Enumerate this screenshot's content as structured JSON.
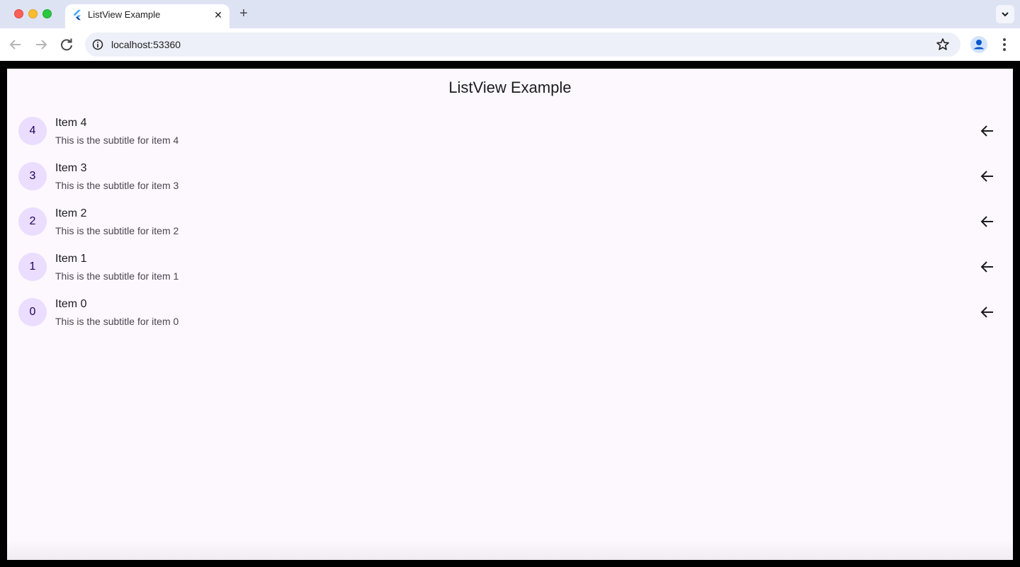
{
  "browser": {
    "tab_title": "ListView Example",
    "tab_close": "✕",
    "new_tab": "+",
    "url": "localhost:53360"
  },
  "colors": {
    "page_background": "#fdf8fd",
    "avatar_background": "#eaddff",
    "avatar_text": "#21005d",
    "title_text": "#1d1b20",
    "subtitle_text": "#49454f"
  },
  "app": {
    "title": "ListView Example",
    "items": [
      {
        "avatar": "4",
        "title": "Item 4",
        "subtitle": "This is the subtitle for item 4",
        "trailing_icon": "arrow-back-icon"
      },
      {
        "avatar": "3",
        "title": "Item 3",
        "subtitle": "This is the subtitle for item 3",
        "trailing_icon": "arrow-back-icon"
      },
      {
        "avatar": "2",
        "title": "Item 2",
        "subtitle": "This is the subtitle for item 2",
        "trailing_icon": "arrow-back-icon"
      },
      {
        "avatar": "1",
        "title": "Item 1",
        "subtitle": "This is the subtitle for item 1",
        "trailing_icon": "arrow-back-icon"
      },
      {
        "avatar": "0",
        "title": "Item 0",
        "subtitle": "This is the subtitle for item 0",
        "trailing_icon": "arrow-back-icon"
      }
    ]
  }
}
